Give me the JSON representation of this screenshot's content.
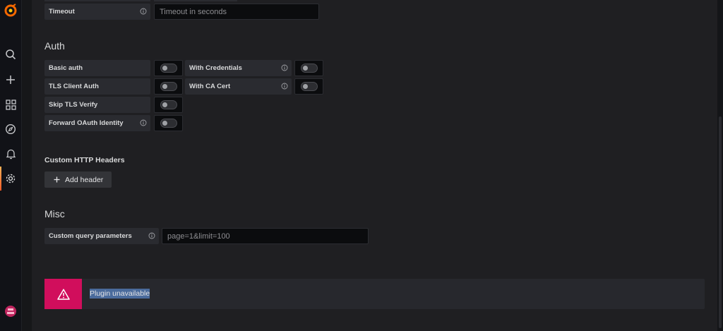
{
  "sidebar": {
    "items": [
      {
        "icon": "grafana-logo-icon"
      },
      {
        "icon": "search-icon"
      },
      {
        "icon": "plus-icon"
      },
      {
        "icon": "dashboards-icon"
      },
      {
        "icon": "explore-icon"
      },
      {
        "icon": "alerting-bell-icon"
      },
      {
        "icon": "gear-icon",
        "active": true
      },
      {
        "icon": "user-avatar-icon"
      }
    ]
  },
  "timeout": {
    "label": "Timeout",
    "placeholder": "Timeout in seconds"
  },
  "auth": {
    "title": "Auth",
    "basic_auth": "Basic auth",
    "with_credentials": "With Credentials",
    "tls_client_auth": "TLS Client Auth",
    "with_ca_cert": "With CA Cert",
    "skip_tls_verify": "Skip TLS Verify",
    "forward_oauth": "Forward OAuth Identity"
  },
  "custom_headers": {
    "title": "Custom HTTP Headers",
    "add_label": "Add header"
  },
  "misc": {
    "title": "Misc",
    "custom_query_label": "Custom query parameters",
    "custom_query_placeholder": "page=1&limit=100"
  },
  "alert": {
    "text": "Plugin unavailable",
    "color": "#d10e5c"
  },
  "colors": {
    "accent": "#f05a28",
    "background": "#1f1f22"
  }
}
